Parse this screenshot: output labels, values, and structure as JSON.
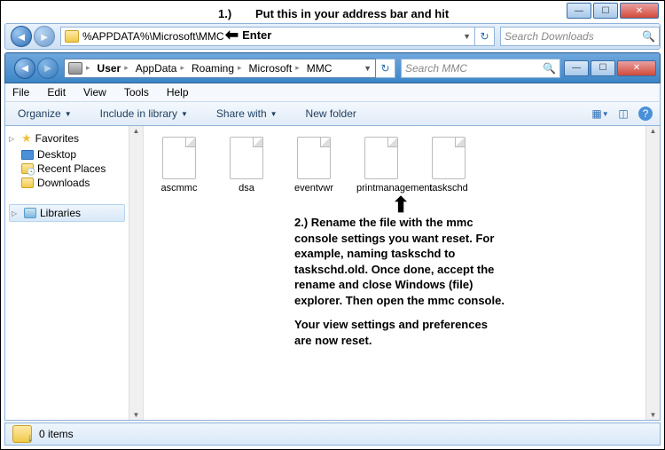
{
  "annotations": {
    "step1_num": "1.)",
    "step1_text": "Put this in your address bar and hit",
    "enter_label": "Enter",
    "step2": "2.) Rename the file with the mmc console settings you want reset. For example, naming taskschd to taskschd.old. Once done, accept the rename and close Windows (file) explorer. Then open the mmc console.",
    "step2b": "Your view settings and preferences are now reset."
  },
  "addr1_value": "%APPDATA%\\Microsoft\\MMC",
  "search1_placeholder": "Search Downloads",
  "search2_placeholder": "Search MMC",
  "breadcrumbs": {
    "b1": "User",
    "b2": "AppData",
    "b3": "Roaming",
    "b4": "Microsoft",
    "b5": "MMC"
  },
  "menu": {
    "file": "File",
    "edit": "Edit",
    "view": "View",
    "tools": "Tools",
    "help": "Help"
  },
  "toolbar": {
    "organize": "Organize",
    "include": "Include in library",
    "share": "Share with",
    "newfolder": "New folder"
  },
  "sidebar": {
    "favorites": "Favorites",
    "desktop": "Desktop",
    "recent": "Recent Places",
    "downloads": "Downloads",
    "libraries": "Libraries"
  },
  "files": {
    "f1": "ascmmc",
    "f2": "dsa",
    "f3": "eventvwr",
    "f4": "printmanagement",
    "f5": "taskschd"
  },
  "status": {
    "count": "0 items"
  }
}
